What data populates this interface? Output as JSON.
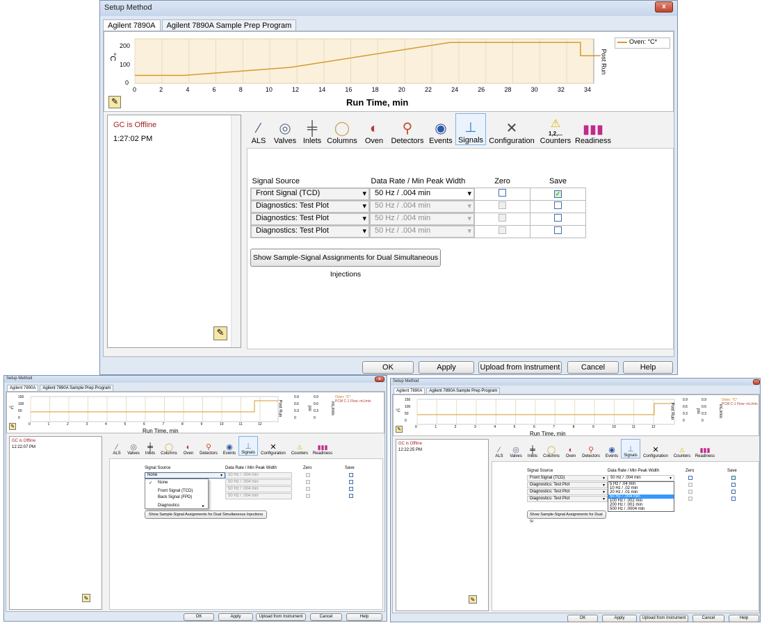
{
  "colors": {
    "oven_line": "#d69a2e",
    "chart_fill": "#faf0dc",
    "status_offline": "#a11f1f",
    "selection": "#3399ff"
  },
  "main": {
    "title": "Setup Method",
    "close_label": "x",
    "tabs": [
      {
        "label": "Agilent 7890A"
      },
      {
        "label": "Agilent 7890A Sample Prep Program"
      }
    ],
    "chart": {
      "y_unit": "°C",
      "y_ticks": [
        "200",
        "100",
        "0"
      ],
      "x_ticks": [
        "0",
        "2",
        "4",
        "6",
        "8",
        "10",
        "12",
        "14",
        "16",
        "18",
        "20",
        "22",
        "24",
        "26",
        "28",
        "30",
        "32",
        "34"
      ],
      "xlabel": "Run Time, min",
      "legend": "Oven: °C*",
      "post_run": "Post Run"
    },
    "status": "GC is Offline",
    "time": "1:27:02 PM",
    "icons": [
      {
        "label": "ALS",
        "icon": "syringe-icon"
      },
      {
        "label": "Valves",
        "icon": "valve-icon"
      },
      {
        "label": "Inlets",
        "icon": "inlet-icon"
      },
      {
        "label": "Columns",
        "icon": "column-icon"
      },
      {
        "label": "Oven",
        "icon": "oven-icon"
      },
      {
        "label": "Detectors",
        "icon": "detector-icon"
      },
      {
        "label": "Events",
        "icon": "events-icon"
      },
      {
        "label": "Signals",
        "icon": "signals-icon"
      },
      {
        "label": "Configuration",
        "icon": "configuration-icon"
      },
      {
        "label": "Counters",
        "icon": "counters-icon"
      },
      {
        "label": "Readiness",
        "icon": "readiness-icon"
      }
    ],
    "counters_mark": "1,2,...",
    "headers": {
      "source": "Signal Source",
      "rate": "Data Rate / Min Peak Width",
      "zero": "Zero",
      "save": "Save"
    },
    "rows": [
      {
        "source": "Front Signal (TCD)",
        "rate": "50 Hz / .004 min",
        "zero": false,
        "save": true
      },
      {
        "source": "Diagnostics: Test Plot",
        "rate": "50 Hz / .004 min",
        "zero": false,
        "save": false
      },
      {
        "source": "Diagnostics: Test Plot",
        "rate": "50 Hz / .004 min",
        "zero": false,
        "save": false
      },
      {
        "source": "Diagnostics: Test Plot",
        "rate": "50 Hz / .004 min",
        "zero": false,
        "save": false
      }
    ],
    "show_button": "Show Sample-Signal Assignments for Dual Simultaneous Injections",
    "buttons": {
      "ok": "OK",
      "apply": "Apply",
      "upload": "Upload from Instrument",
      "cancel": "Cancel",
      "help": "Help"
    }
  },
  "bottom_left": {
    "title": "Setup Method",
    "tabs": [
      {
        "label": "Agilent 7890A"
      },
      {
        "label": "Agilent 7890A Sample Prep Program"
      }
    ],
    "chart": {
      "y_unit": "°C",
      "y_ticks": [
        "150",
        "100",
        "50",
        "0"
      ],
      "x_ticks": [
        "0",
        "1",
        "2",
        "3",
        "4",
        "5",
        "6",
        "7",
        "8",
        "9",
        "10",
        "11",
        "12"
      ],
      "xlabel": "Run Time, min",
      "right_ticks_a": [
        "0.9",
        "0.6",
        "0.3",
        "0"
      ],
      "right_ticks_b": [
        "0.9",
        "0.6",
        "0.3",
        "0"
      ],
      "psi": "psi",
      "flow": "mL/min",
      "legend_oven": "Oven: °C*",
      "legend_pcm": "PCM C-1 Flow: mL/min",
      "post_run": "Post Run"
    },
    "status": "GC is Offline",
    "time": "12:22:07 PM",
    "rate": "50 Hz / .004 min",
    "first_source": "None",
    "menu": [
      "None",
      "Front Signal (TCD)",
      "Back Signal (FPD)",
      "Diagnostics"
    ],
    "menu_check": "✓",
    "menu_sub": "▸",
    "show_button": "Show Sample-Signal Assignments for Dual Simultaneous Injections"
  },
  "bottom_right": {
    "title": "Setup Method",
    "tabs": [
      {
        "label": "Agilent 7890A"
      },
      {
        "label": "Agilent 7890A Sample Prep Program"
      }
    ],
    "chart": {
      "y_ticks": [
        "150",
        "100",
        "50",
        "0"
      ],
      "x_ticks": [
        "0",
        "1",
        "2",
        "3",
        "4",
        "5",
        "6",
        "7",
        "8",
        "9",
        "10",
        "11",
        "12"
      ],
      "xlabel": "Run Time, min",
      "right_ticks_a": [
        "0.9",
        "0.6",
        "0.3",
        "0"
      ],
      "right_ticks_b": [
        "0.9",
        "0.6",
        "0.3",
        "0"
      ],
      "legend_oven": "Oven: °C*",
      "legend_pcm": "PCM C-1 Flow: mL/min"
    },
    "status": "GC is Offline",
    "time": "12:22:25 PM",
    "sources": [
      "Front Signal (TCD)",
      "Diagnostics: Test Plot",
      "Diagnostics: Test Plot",
      "Diagnostics: Test Plot"
    ],
    "rate": "50 Hz / .004 min",
    "rate_options": [
      "5 Hz / .04 min",
      "10 Hz / .02 min",
      "20 Hz / .01 min",
      "50 Hz / .004 min",
      "100 Hz / .002 min",
      "200 Hz / .001 min",
      "500 Hz / .0004 min"
    ],
    "selected_option": 3,
    "show_button": "Show Sample-Signal Assignments for Dual Si"
  }
}
